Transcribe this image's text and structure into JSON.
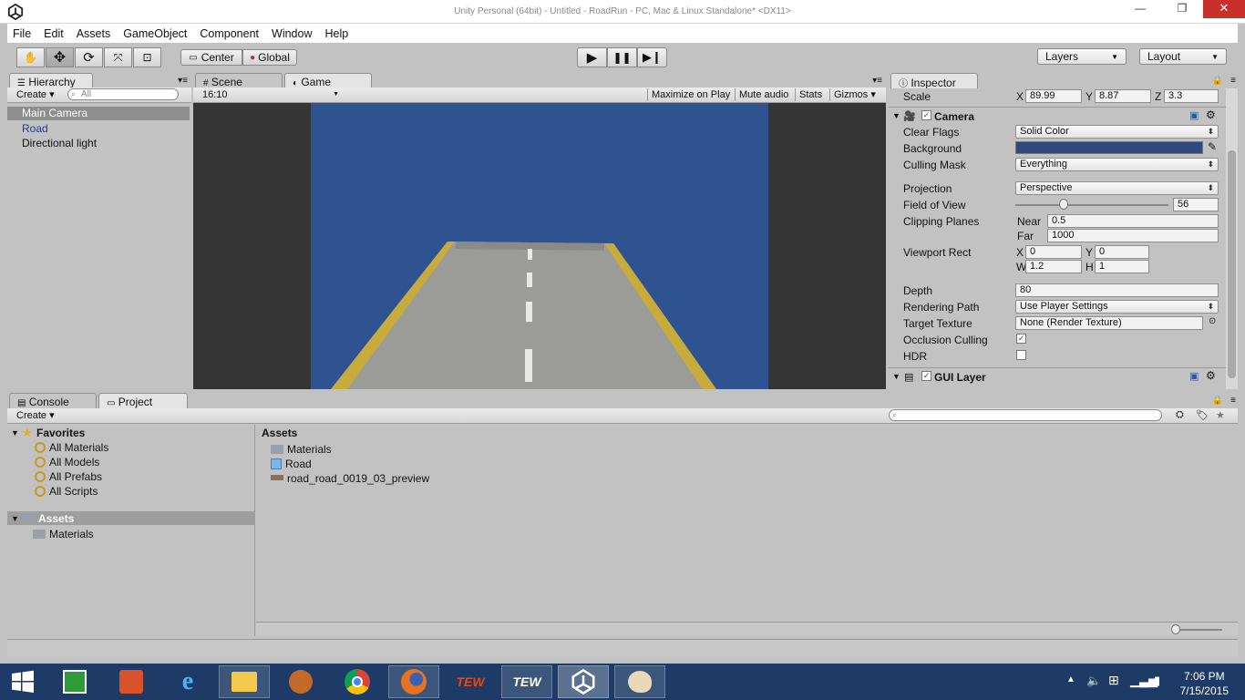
{
  "window": {
    "title": "Unity Personal (64bit) - Untitled - RoadRun - PC, Mac & Linux Standalone* <DX11>"
  },
  "menu": [
    "File",
    "Edit",
    "Assets",
    "GameObject",
    "Component",
    "Window",
    "Help"
  ],
  "toolbar": {
    "pivot": "Center",
    "space": "Global",
    "layers": "Layers",
    "layout": "Layout"
  },
  "hierarchy": {
    "tab": "Hierarchy",
    "create": "Create",
    "search_placeholder": "All",
    "items": [
      {
        "name": "Main Camera",
        "state": "selected"
      },
      {
        "name": "Road",
        "state": "prefab"
      },
      {
        "name": "Directional light",
        "state": "normal"
      }
    ]
  },
  "scene_tab": "Scene",
  "game": {
    "tab": "Game",
    "aspect": "16:10",
    "buttons": [
      "Maximize on Play",
      "Mute audio",
      "Stats",
      "Gizmos"
    ],
    "sky_color": "#2f5290"
  },
  "inspector": {
    "tab": "Inspector",
    "scale": {
      "label": "Scale",
      "x": "89.99",
      "y": "8.87",
      "z": "3.3"
    },
    "camera": {
      "title": "Camera",
      "clear_flags_label": "Clear Flags",
      "clear_flags": "Solid Color",
      "background_label": "Background",
      "background_color": "#2f4a7a",
      "culling_mask_label": "Culling Mask",
      "culling_mask": "Everything",
      "projection_label": "Projection",
      "projection": "Perspective",
      "fov_label": "Field of View",
      "fov": "56",
      "clipping_label": "Clipping Planes",
      "near_label": "Near",
      "near": "0.5",
      "far_label": "Far",
      "far": "1000",
      "viewport_label": "Viewport Rect",
      "vx": "0",
      "vy": "0",
      "vw": "1.2",
      "vh": "1",
      "depth_label": "Depth",
      "depth": "80",
      "rendering_path_label": "Rendering Path",
      "rendering_path": "Use Player Settings",
      "target_texture_label": "Target Texture",
      "target_texture": "None (Render Texture)",
      "occlusion_label": "Occlusion Culling",
      "hdr_label": "HDR"
    },
    "gui_layer": "GUI Layer"
  },
  "bottom": {
    "console_tab": "Console",
    "project_tab": "Project",
    "create": "Create",
    "favorites_label": "Favorites",
    "favorites": [
      "All Materials",
      "All Models",
      "All Prefabs",
      "All Scripts"
    ],
    "assets_label": "Assets",
    "assets_children": [
      "Materials"
    ],
    "assets_header": "Assets",
    "asset_items": [
      {
        "name": "Materials",
        "icon": "folder-icon"
      },
      {
        "name": "Road",
        "icon": "prefab-cube-icon"
      },
      {
        "name": "road_road_0019_03_preview",
        "icon": "texture-icon"
      }
    ]
  },
  "taskbar": {
    "time": "7:06 PM",
    "date": "7/15/2015"
  }
}
